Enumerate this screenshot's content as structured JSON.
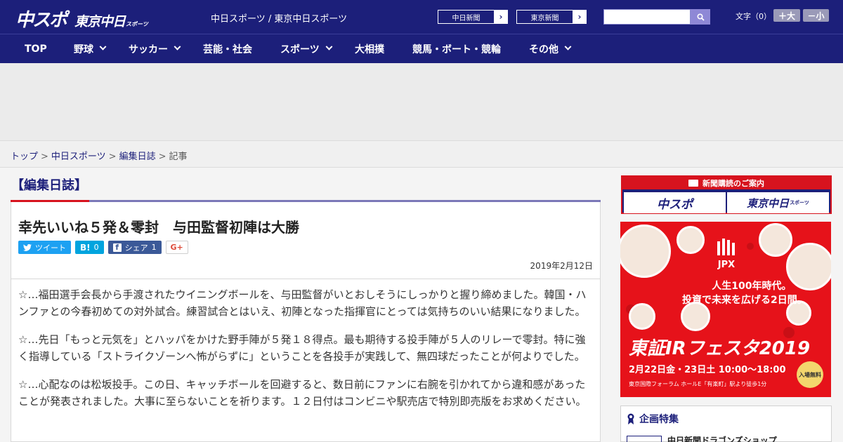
{
  "header": {
    "logo_main": "中スポ",
    "logo_sub": "東京中日",
    "logo_tiny": "スポーツ",
    "title": "中日スポーツ / 東京中日スポーツ",
    "paper_links": [
      "中日新聞",
      "東京新聞"
    ],
    "search_placeholder": "",
    "font_size_label": "文字（0）",
    "font_larger": "＋大",
    "font_smaller": "－小",
    "accent_color": "#1c1f7a"
  },
  "nav": {
    "items": [
      {
        "label": "TOP",
        "dropdown": false
      },
      {
        "label": "野球",
        "dropdown": true
      },
      {
        "label": "サッカー",
        "dropdown": true
      },
      {
        "label": "芸能・社会",
        "dropdown": false
      },
      {
        "label": "スポーツ",
        "dropdown": true
      },
      {
        "label": "大相撲",
        "dropdown": false
      },
      {
        "label": "競馬・ボート・競輪",
        "dropdown": false
      },
      {
        "label": "その他",
        "dropdown": true
      }
    ]
  },
  "breadcrumb": {
    "items": [
      "トップ",
      "中日スポーツ",
      "編集日誌"
    ],
    "current": "記事",
    "separator": ">"
  },
  "section": {
    "title": "【編集日誌】"
  },
  "article": {
    "title": "幸先いいね５発＆零封　与田監督初陣は大勝",
    "date": "2019年2月12日",
    "share": {
      "tweet": "ツイート",
      "hatena_icon": "B!",
      "hatena_count": "0",
      "facebook_icon": "f",
      "facebook_label": "シェア",
      "facebook_count": "1",
      "gplus": "G+"
    },
    "paragraphs": [
      "☆…福田選手会長から手渡されたウイニングボールを、与田監督がいとおしそうにしっかりと握り締めました。韓国・ハンファとの今春初めての対外試合。練習試合とはいえ、初陣となった指揮官にとっては気持ちのいい結果になりました。",
      "☆…先日「もっと元気を」とハッパをかけた野手陣が５発１８得点。最も期待する投手陣が５人のリレーで零封。特に強く指導している「ストライクゾーンへ怖がらずに」ということを各投手が実践して、無四球だったことが何よりでした。",
      "☆…心配なのは松坂投手。この日、キャッチボールを回避すると、数日前にファンに右腕を引かれてから違和感があったことが発表されました。大事に至らないことを祈ります。１２日付はコンビニや駅売店で特別即売版をお求めください。"
    ]
  },
  "sidebar": {
    "subscription": {
      "heading": "新聞購読のご案内",
      "button1": "中スポ",
      "button2": "東京中日",
      "button2_tiny": "スポーツ"
    },
    "ad": {
      "logo": "JPX",
      "tagline_line1": "人生100年時代。",
      "tagline_line2": "投資で未来を広げる2日間。",
      "event": "東証IRフェスタ2019",
      "dates": "2月22日金・23日土 10:00〜18:00",
      "venue": "東京国際フォーラム ホールE「有楽町」駅より徒歩1分",
      "badge": "入場無料",
      "bg_color": "#e6121a"
    },
    "feature": {
      "title": "企画特集",
      "first_item": "中日新聞ドラゴンズショップ"
    }
  }
}
